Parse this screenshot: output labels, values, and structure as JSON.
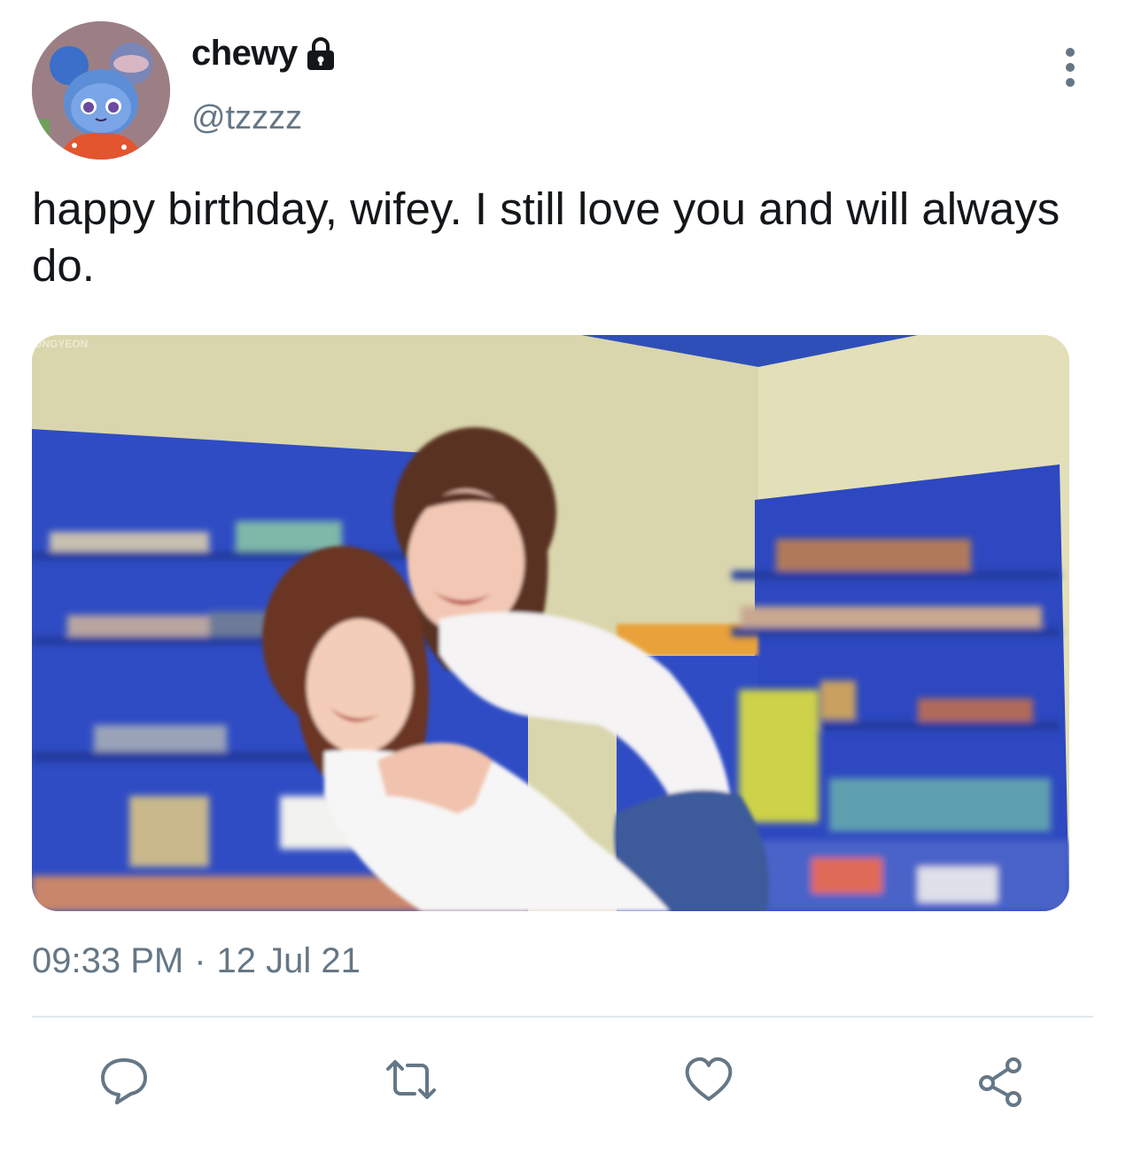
{
  "tweet": {
    "display_name": "chewy",
    "handle": "@tzzzz",
    "protected": true,
    "text": "happy birthday, wifey. I still love you and will always do.",
    "time": "09:33 PM",
    "separator": "·",
    "date": "12 Jul 21",
    "media_watermark": "ONGYEON"
  },
  "icons": {
    "lock": "lock-icon",
    "more": "more-vertical-icon",
    "reply": "reply-icon",
    "retweet": "retweet-icon",
    "like": "heart-icon",
    "share": "share-icon"
  },
  "colors": {
    "text": "#14171a",
    "secondary": "#657786",
    "divider": "#e1e8ed"
  }
}
